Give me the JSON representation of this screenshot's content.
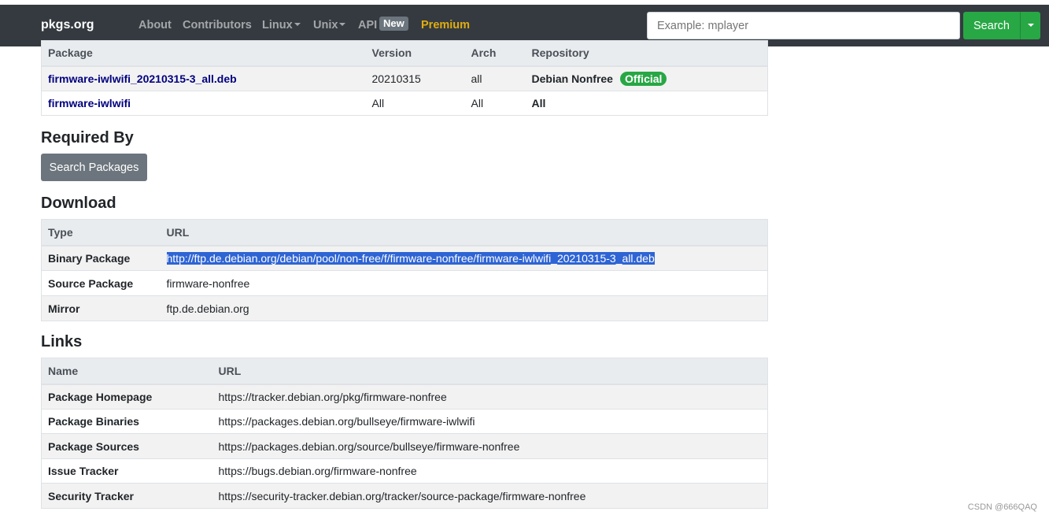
{
  "nav": {
    "brand": "pkgs.org",
    "items": [
      "About",
      "Contributors",
      "Linux",
      "Unix",
      "API"
    ],
    "api_badge": "New",
    "premium": "Premium",
    "search_placeholder": "Example: mplayer",
    "search_button": "Search"
  },
  "packages_table": {
    "headers": [
      "Package",
      "Version",
      "Arch",
      "Repository"
    ],
    "rows": [
      {
        "package": "firmware-iwlwifi_20210315-3_all.deb",
        "version": "20210315",
        "arch": "all",
        "repository": "Debian Nonfree",
        "badge": "Official"
      },
      {
        "package": "firmware-iwlwifi",
        "version": "All",
        "arch": "All",
        "repository": "All"
      }
    ]
  },
  "required_by": {
    "title": "Required By",
    "button": "Search Packages"
  },
  "download": {
    "title": "Download",
    "headers": [
      "Type",
      "URL"
    ],
    "rows": [
      {
        "type": "Binary Package",
        "url": "http://ftp.de.debian.org/debian/pool/non-free/f/firmware-nonfree/firmware-iwlwifi_20210315-3_all.deb"
      },
      {
        "type": "Source Package",
        "url": "firmware-nonfree"
      },
      {
        "type": "Mirror",
        "url": "ftp.de.debian.org"
      }
    ]
  },
  "links": {
    "title": "Links",
    "headers": [
      "Name",
      "URL"
    ],
    "rows": [
      {
        "name": "Package Homepage",
        "url": "https://tracker.debian.org/pkg/firmware-nonfree"
      },
      {
        "name": "Package Binaries",
        "url": "https://packages.debian.org/bullseye/firmware-iwlwifi"
      },
      {
        "name": "Package Sources",
        "url": "https://packages.debian.org/source/bullseye/firmware-nonfree"
      },
      {
        "name": "Issue Tracker",
        "url": "https://bugs.debian.org/firmware-nonfree"
      },
      {
        "name": "Security Tracker",
        "url": "https://security-tracker.debian.org/tracker/source-package/firmware-nonfree"
      }
    ]
  },
  "watermark": "CSDN @666QAQ",
  "colors": {
    "navbar": "#343a40",
    "accent_green": "#28a745",
    "premium": "#ffc107",
    "link": "#00007f",
    "selection": "#2e64d4"
  }
}
